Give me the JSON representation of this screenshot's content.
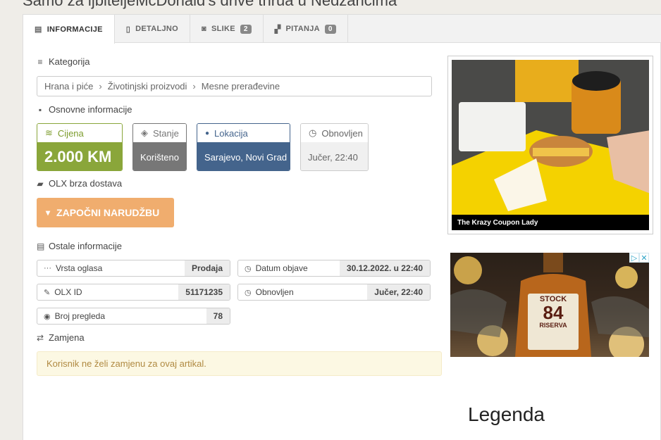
{
  "page_title": "Samo za ljbiteljeMcDonald's drive thrua u Nedzarićima",
  "tabs": [
    {
      "label": "INFORMACIJE",
      "icon": "list-alt-icon",
      "active": true
    },
    {
      "label": "DETALJNO",
      "icon": "file-icon"
    },
    {
      "label": "SLIKE",
      "icon": "camera-icon",
      "count": "2"
    },
    {
      "label": "PITANJA",
      "icon": "comments-icon",
      "count": "0"
    }
  ],
  "category": {
    "label": "Kategorija",
    "crumbs": [
      "Hrana i piće",
      "Životinjski proizvodi",
      "Mesne prerađevine"
    ]
  },
  "basic_info": {
    "label": "Osnovne informacije",
    "price_label": "Cijena",
    "price_value": "2.000 KM",
    "state_label": "Stanje",
    "state_value": "Korišteno",
    "location_label": "Lokacija",
    "location_value": "Sarajevo, Novi Grad",
    "updated_label": "Obnovljen",
    "updated_value": "Jučer, 22:40"
  },
  "delivery": {
    "label": "OLX brza dostava",
    "order_button": "ZAPOČNI NARUDŽBU"
  },
  "other_info": {
    "label": "Ostale informacije",
    "items": [
      {
        "label": "Vrsta oglasa",
        "value": "Prodaja",
        "icon": "ellipsis-icon"
      },
      {
        "label": "Datum objave",
        "value": "30.12.2022. u 22:40",
        "icon": "clock-icon"
      },
      {
        "label": "OLX ID",
        "value": "51171235",
        "icon": "wrench-icon"
      },
      {
        "label": "Obnovljen",
        "value": "Jučer, 22:40",
        "icon": "clock-icon"
      },
      {
        "label": "Broj pregleda",
        "value": "78",
        "icon": "eye-icon"
      }
    ]
  },
  "swap": {
    "label": "Zamjena",
    "note": "Korisnik ne želi zamjenu za ovaj artikal."
  },
  "ads": {
    "ad1_caption": "The Krazy Coupon Lady",
    "ad2_brand": "STOCK",
    "ad2_number": "84",
    "ad2_sub": "RISERVA",
    "ad2_headline": "Legenda"
  },
  "colors": {
    "price": "#8aa63a",
    "state": "#777777",
    "location": "#44648c",
    "order_button": "#f0ad6e",
    "swap_note_bg": "#fcf8e3"
  }
}
